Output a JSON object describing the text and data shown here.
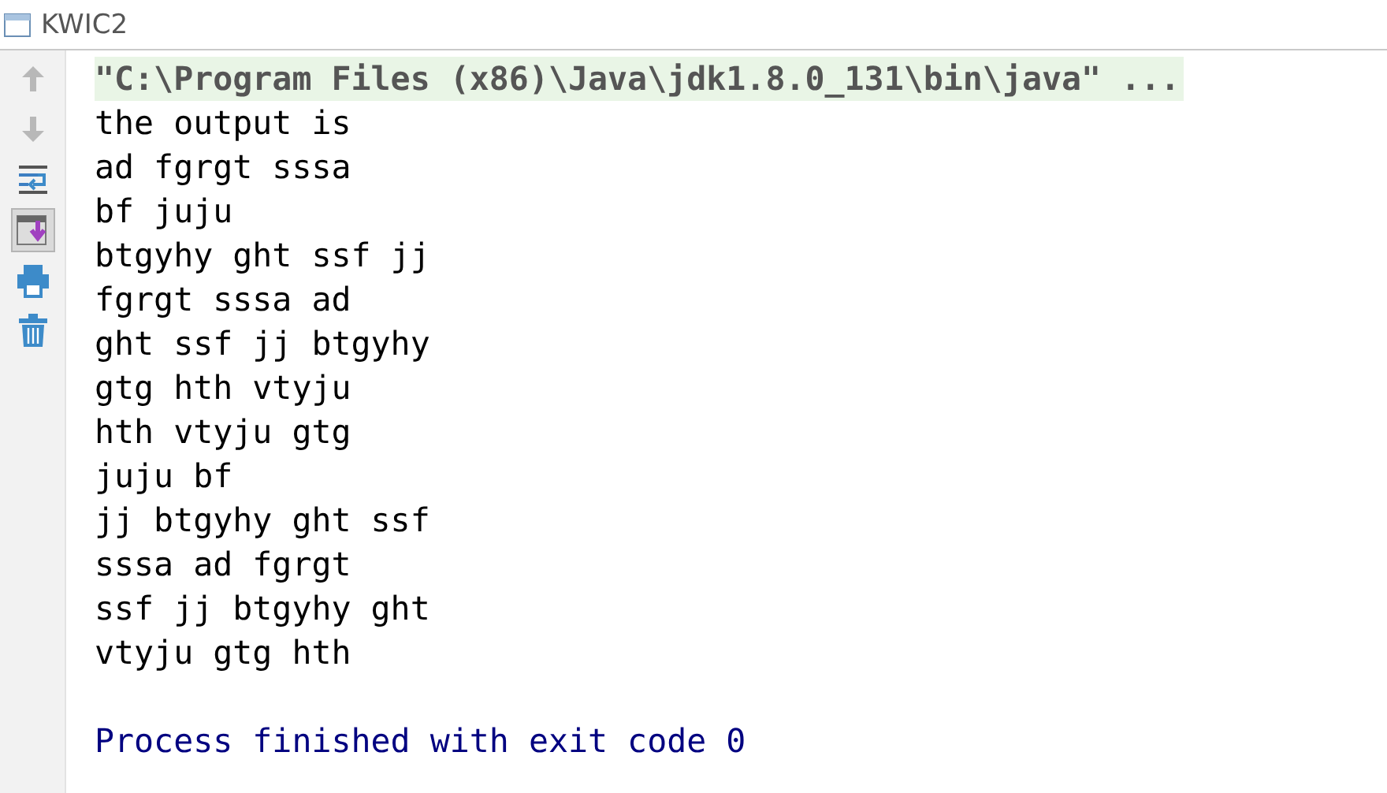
{
  "window": {
    "title": "KWIC2"
  },
  "tools": [
    {
      "kind": "up",
      "disabled": true,
      "on": false
    },
    {
      "kind": "down",
      "disabled": true,
      "on": false
    },
    {
      "kind": "wrap",
      "disabled": false,
      "on": false
    },
    {
      "kind": "scroll-end",
      "disabled": false,
      "on": true
    },
    {
      "kind": "print",
      "disabled": false,
      "on": false
    },
    {
      "kind": "trash",
      "disabled": false,
      "on": false
    }
  ],
  "output": [
    {
      "kind": "command",
      "text": "\"C:\\Program Files (x86)\\Java\\jdk1.8.0_131\\bin\\java\" ..."
    },
    {
      "kind": "stdout",
      "text": "the output is"
    },
    {
      "kind": "stdout",
      "text": "ad fgrgt sssa"
    },
    {
      "kind": "stdout",
      "text": "bf juju"
    },
    {
      "kind": "stdout",
      "text": "btgyhy ght ssf jj"
    },
    {
      "kind": "stdout",
      "text": "fgrgt sssa ad"
    },
    {
      "kind": "stdout",
      "text": "ght ssf jj btgyhy"
    },
    {
      "kind": "stdout",
      "text": "gtg hth vtyju"
    },
    {
      "kind": "stdout",
      "text": "hth vtyju gtg"
    },
    {
      "kind": "stdout",
      "text": "juju bf"
    },
    {
      "kind": "stdout",
      "text": "jj btgyhy ght ssf"
    },
    {
      "kind": "stdout",
      "text": "sssa ad fgrgt"
    },
    {
      "kind": "stdout",
      "text": "ssf jj btgyhy ght"
    },
    {
      "kind": "stdout",
      "text": "vtyju gtg hth"
    },
    {
      "kind": "system",
      "text": "Process finished with exit code 0"
    }
  ]
}
